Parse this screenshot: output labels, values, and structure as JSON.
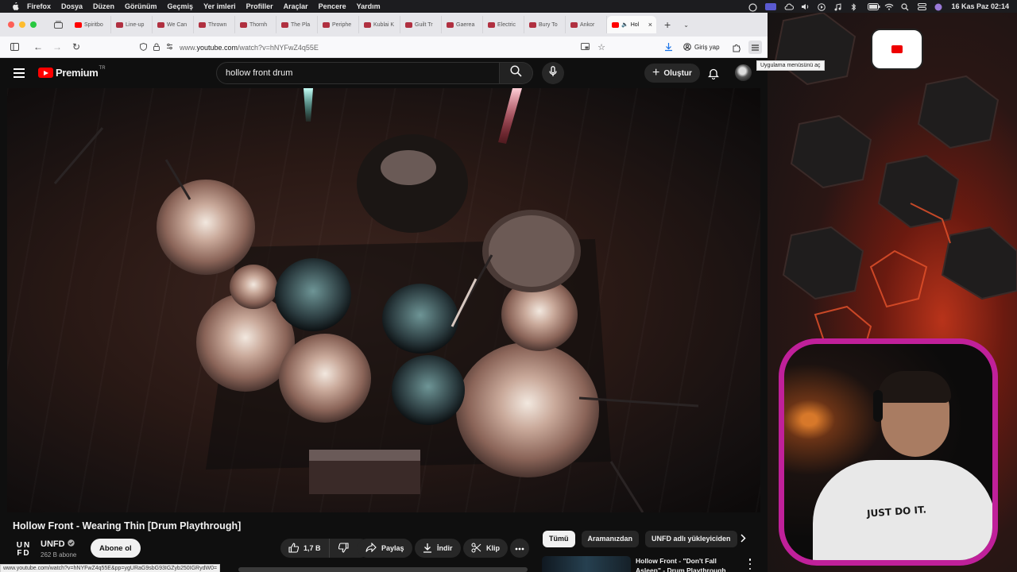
{
  "menubar": {
    "items": [
      "Firefox",
      "Dosya",
      "Düzen",
      "Görünüm",
      "Geçmiş",
      "Yer imleri",
      "Profiller",
      "Araçlar",
      "Pencere",
      "Yardım"
    ],
    "datetime": "16 Kas Paz  02:14"
  },
  "browser": {
    "tabs": [
      {
        "label": "Spiritbo",
        "favicon_color": "#ff0000"
      },
      {
        "label": "Line-up",
        "favicon_color": "#b03040"
      },
      {
        "label": "We Can",
        "favicon_color": "#b03040"
      },
      {
        "label": "Thrown",
        "favicon_color": "#b03040"
      },
      {
        "label": "Thornh",
        "favicon_color": "#b03040"
      },
      {
        "label": "The Pla",
        "favicon_color": "#b03040"
      },
      {
        "label": "Periphe",
        "favicon_color": "#b03040"
      },
      {
        "label": "Kublai K",
        "favicon_color": "#b03040"
      },
      {
        "label": "Guilt Tr",
        "favicon_color": "#b03040"
      },
      {
        "label": "Gaerea",
        "favicon_color": "#b03040"
      },
      {
        "label": "Electric",
        "favicon_color": "#b03040"
      },
      {
        "label": "Bury To",
        "favicon_color": "#b03040"
      },
      {
        "label": "Ankor",
        "favicon_color": "#b03040"
      }
    ],
    "active_tab": {
      "label": "Hol",
      "close": "×"
    },
    "new_tab": "+",
    "url_prefix": "www.",
    "url_host": "youtube.com",
    "url_path": "/watch?v=hNYFwZ4q55E",
    "signin_label": "Giriş yap",
    "appmenu_tooltip": "Uygulama menüsünü aç",
    "status_url": "www.youtube.com/watch?v=hNYFwZ4q55E&pp=ygURaG9sbG93IGZyb250IGRydW0="
  },
  "youtube": {
    "logo_word": "Premium",
    "logo_region": "TR",
    "search_value": "hollow front drum",
    "create_label": "Oluştur",
    "video_title": "Hollow Front - Wearing Thin [Drum Playthrough]",
    "channel": {
      "logo_line1": "UN",
      "logo_line2": "FD",
      "name": "UNFD",
      "subscribers": "262 B abone",
      "subscribe_label": "Abone ol"
    },
    "actions": {
      "likes": "1,7 B",
      "share": "Paylaş",
      "download": "İndir",
      "clip": "Klip"
    },
    "chips": [
      "Tümü",
      "Aramanızdan",
      "UNFD adlı yükleyiciden"
    ],
    "recommendation_title": "Hollow Front - \"Don't Fall Asleep\" - Drum Playthrough"
  },
  "webcam": {
    "shirt_text": "JUST DO IT."
  }
}
